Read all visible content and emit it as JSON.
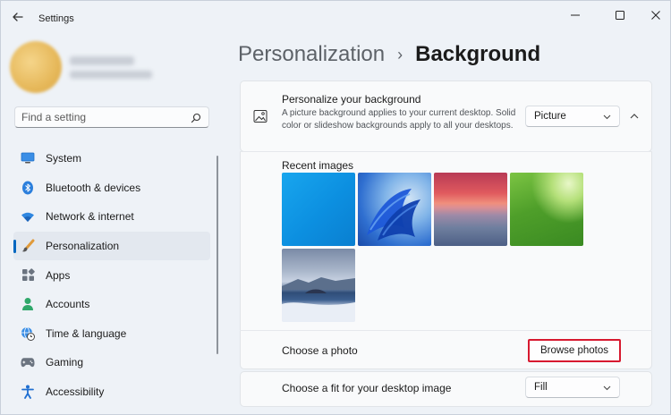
{
  "window": {
    "title": "Settings"
  },
  "search": {
    "placeholder": "Find a setting"
  },
  "nav": [
    {
      "label": "System",
      "icon": "monitor-icon"
    },
    {
      "label": "Bluetooth & devices",
      "icon": "bluetooth-icon"
    },
    {
      "label": "Network & internet",
      "icon": "wifi-icon"
    },
    {
      "label": "Personalization",
      "icon": "brush-icon",
      "active": true
    },
    {
      "label": "Apps",
      "icon": "apps-icon"
    },
    {
      "label": "Accounts",
      "icon": "person-icon"
    },
    {
      "label": "Time & language",
      "icon": "globe-clock-icon"
    },
    {
      "label": "Gaming",
      "icon": "gamepad-icon"
    },
    {
      "label": "Accessibility",
      "icon": "accessibility-icon"
    }
  ],
  "breadcrumb": {
    "parent": "Personalization",
    "separator": "›",
    "current": "Background"
  },
  "background": {
    "title": "Personalize your background",
    "description": "A picture background applies to your current desktop. Solid color or slideshow backgrounds apply to all your desktops.",
    "type_value": "Picture",
    "recent_label": "Recent images",
    "recent_images": [
      "blue-solid",
      "windows-bloom",
      "sunset-water",
      "green-light",
      "crater-lake"
    ],
    "choose_label": "Choose a photo",
    "browse_label": "Browse photos",
    "fit_label": "Choose a fit for your desktop image",
    "fit_value": "Fill"
  },
  "colors": {
    "accent": "#0067c0",
    "highlight": "#d7192f"
  }
}
